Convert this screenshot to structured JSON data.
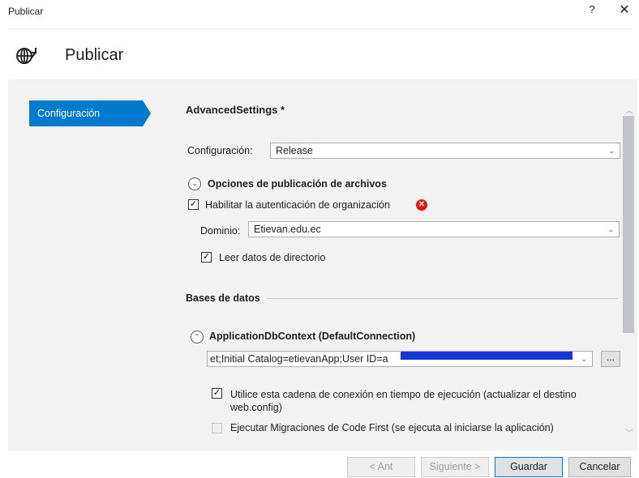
{
  "window": {
    "title": "Publicar",
    "help_label": "?",
    "close_label": "✕"
  },
  "header": {
    "title": "Publicar",
    "icon": "globe-arrow-icon"
  },
  "sidebar": {
    "items": [
      {
        "label": "Configuración",
        "selected": true
      }
    ]
  },
  "main": {
    "section_title": "AdvancedSettings *",
    "config_label": "Configuración:",
    "config_value": "Release",
    "file_options": {
      "title": "Opciones de publicación de archivos",
      "expanded": true,
      "enable_auth_label": "Habilitar la autenticación de organización",
      "enable_auth_checked": true,
      "error_icon": "error-icon",
      "domain_label": "Dominio:",
      "domain_value": "Etievan.edu.ec",
      "read_directory_label": "Leer datos de directorio",
      "read_directory_checked": true
    },
    "databases": {
      "title": "Bases de datos",
      "context": {
        "title": "ApplicationDbContext (DefaultConnection)",
        "expanded": true,
        "connection_string": "et;Initial Catalog=etievanApp;User ID=a",
        "browse_label": "...",
        "use_runtime_label": "Utilice esta cadena de conexión en tiempo de ejecución (actualizar el destino web.config)",
        "use_runtime_checked": true,
        "migrations_label": "Ejecutar Migraciones de Code First (se ejecuta al iniciarse la aplicación)",
        "migrations_checked": false,
        "migrations_enabled": false
      }
    }
  },
  "footer": {
    "prev_label": "< Ant",
    "next_label": "Siguiente >",
    "save_label": "Guardar",
    "cancel_label": "Cancelar"
  },
  "colors": {
    "accent": "#007acc",
    "error": "#e51400",
    "redaction": "#1736d6"
  }
}
